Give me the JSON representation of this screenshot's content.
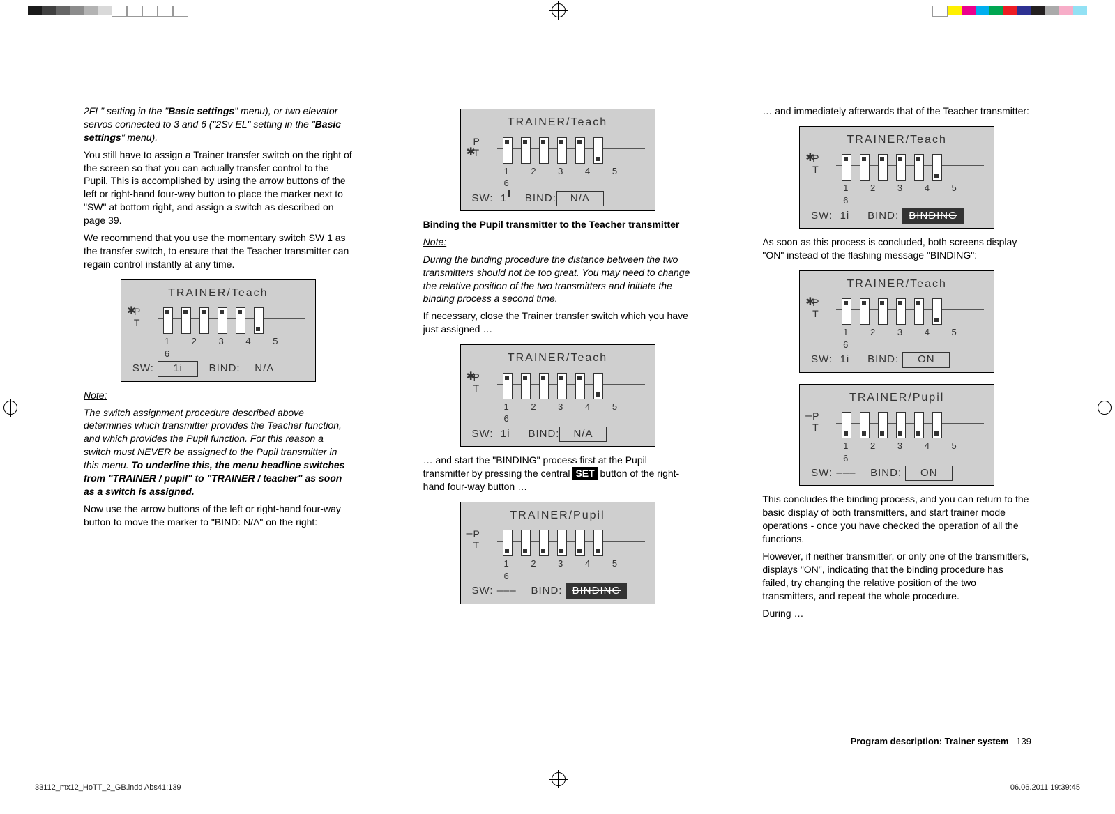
{
  "col1": {
    "p1a": "2FL\" setting in the \"",
    "p1b": "Basic settings",
    "p1c": "\" menu), or two elevator servos connected to 3 and 6 (\"2Sv EL\" setting in the \"",
    "p1d": "Basic settings",
    "p1e": "\" menu).",
    "p2": "You still have to assign a Trainer transfer switch on the right of the screen so that you can actually transfer control to the Pupil. This is accomplished by using the arrow buttons of the left or right-hand four-way button to place the marker next to \"SW\" at bottom right, and assign a switch as described on page 39.",
    "p3": "We recommend that you use the momentary switch SW 1 as the transfer switch, to ensure that the Teacher transmitter can regain control instantly at any time.",
    "note_label": "Note:",
    "note1a": "The switch assignment procedure described above determines which transmitter provides the Teacher function, and which provides the Pupil function. For this reason a switch must NEVER be assigned to the Pupil transmitter in this menu. ",
    "note1b": "To underline this, the menu headline switches from \"TRAINER / pupil\" to \"TRAINER / teacher\" as soon as a switch is assigned.",
    "p4": "Now use the arrow buttons of the left or right-hand four-way button to move the marker to \"BIND: N/A\" on the right:"
  },
  "col2": {
    "h1": "Binding the Pupil transmitter to the Teacher transmitter",
    "note_label": "Note:",
    "note": "During the binding procedure the distance between the two transmitters should not be too great. You may need to change the relative position of the two transmitters and initiate the binding process a second time.",
    "p1": "If necessary, close the Trainer transfer switch which you have just assigned …",
    "p2a": "… and start the \"BINDING\" process first at the Pupil transmitter by pressing the central ",
    "p2b": "SET",
    "p2c": " button of the right-hand four-way button …"
  },
  "col3": {
    "p1": "… and immediately afterwards that of the Teacher transmitter:",
    "p2": "As soon as this process is concluded, both screens display \"ON\" instead of the flashing message \"BINDING\":",
    "p3": "This concludes the binding process, and you can return to the basic display of both transmitters, and start trainer mode operations - once you have checked the operation of all the functions.",
    "p4": "However, if neither transmitter, or only one of the transmitters, displays \"ON\", indicating that the binding procedure has failed, try changing the relative position of the two transmitters, and repeat the whole procedure.",
    "p5": "During …"
  },
  "diagrams": {
    "teach": "TRAINER/Teach",
    "pupil": "TRAINER/Pupil",
    "nums": "1 2 3 4 5 6",
    "sw": "SW:",
    "bind": "BIND:",
    "na": "N/A",
    "on": "ON",
    "binding": "BINDING",
    "one": "1",
    "onei": "1i",
    "dash": "–––",
    "P": "P",
    "T": "T",
    "minus": "–"
  },
  "footer": {
    "section": "Program description: Trainer system",
    "page": "139",
    "file": "33112_mx12_HoTT_2_GB.indd   Abs41:139",
    "date": "06.06.2011   19:39:45"
  }
}
